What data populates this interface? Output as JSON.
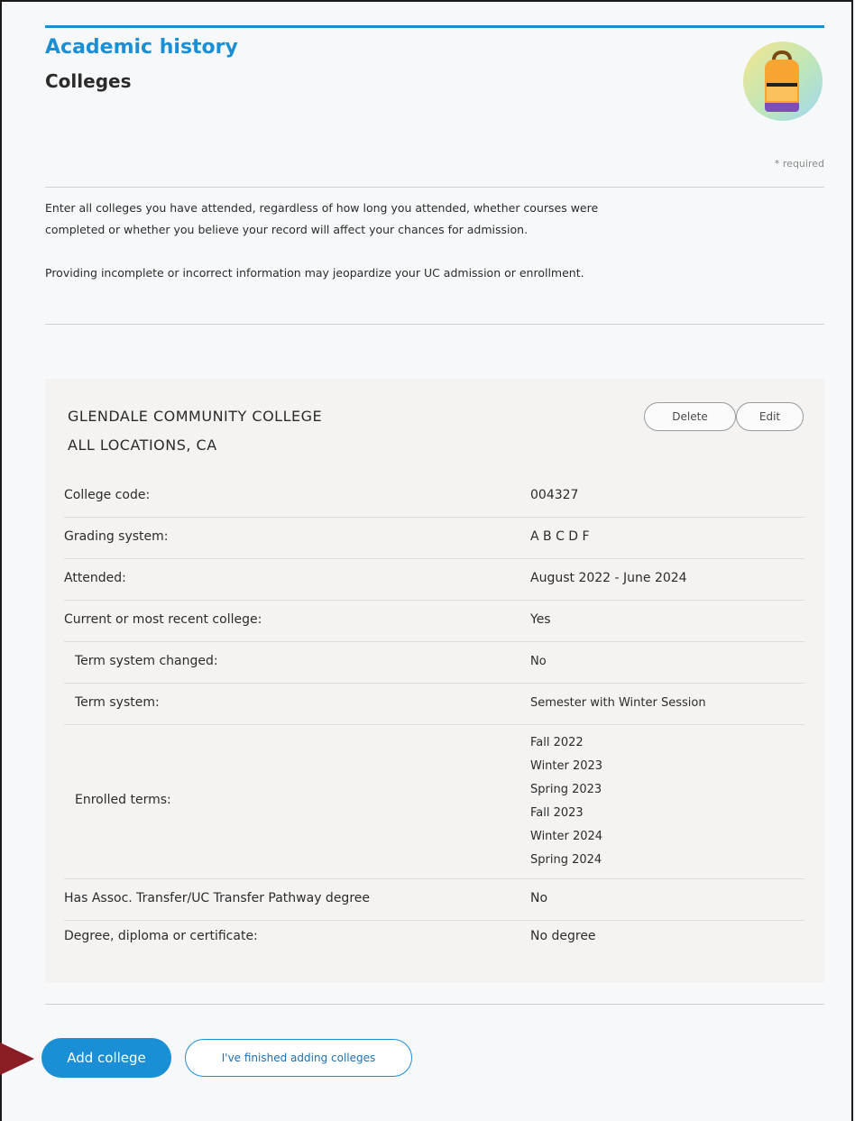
{
  "header": {
    "section_title": "Academic history",
    "page_title": "Colleges",
    "required_note": "* required"
  },
  "intro": {
    "paragraph1": "Enter all colleges you have attended, regardless of how long you attended, whether courses were completed or whether you believe your record will affect your chances for admission.",
    "paragraph2": "Providing incomplete or incorrect information may jeopardize your UC admission or enrollment."
  },
  "college": {
    "name_line1": "GLENDALE COMMUNITY COLLEGE",
    "name_line2": "ALL LOCATIONS, CA",
    "delete_label": "Delete",
    "edit_label": "Edit",
    "details": [
      {
        "label": "College code:",
        "value": "004327"
      },
      {
        "label": "Grading system:",
        "value": "A B C D F"
      },
      {
        "label": "Attended:",
        "value": "August 2022 - June 2024"
      },
      {
        "label": "Current or most recent college:",
        "value": "Yes"
      },
      {
        "label": "Term system changed:",
        "value": "No"
      },
      {
        "label": "Term system:",
        "value": "Semester with Winter Session"
      },
      {
        "label": "Enrolled terms:",
        "value": ""
      },
      {
        "label": "Has Assoc. Transfer/UC Transfer Pathway degree",
        "value": "No"
      },
      {
        "label": "Degree, diploma or certificate:",
        "value": "No degree"
      }
    ],
    "enrolled_terms": [
      "Fall 2022",
      "Winter 2023",
      "Spring 2023",
      "Fall 2023",
      "Winter 2024",
      "Spring 2024"
    ]
  },
  "actions": {
    "add_college": "Add college",
    "finished": "I've finished adding colleges"
  },
  "colors": {
    "accent": "#1b8fd6",
    "arrow": "#8b1d24",
    "card_bg": "#f5f3f1"
  }
}
